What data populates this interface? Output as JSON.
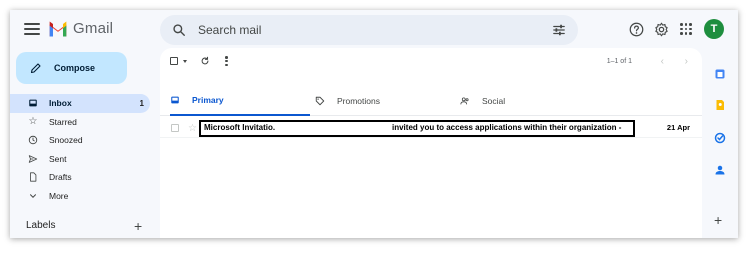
{
  "app": {
    "name": "Gmail",
    "avatar_initial": "T"
  },
  "search": {
    "placeholder": "Search mail"
  },
  "compose": {
    "label": "Compose"
  },
  "nav": {
    "items": [
      {
        "label": "Inbox",
        "count": "1",
        "icon": "inbox-icon"
      },
      {
        "label": "Starred",
        "count": "",
        "icon": "star-icon"
      },
      {
        "label": "Snoozed",
        "count": "",
        "icon": "clock-icon"
      },
      {
        "label": "Sent",
        "count": "",
        "icon": "send-icon"
      },
      {
        "label": "Drafts",
        "count": "",
        "icon": "draft-icon"
      },
      {
        "label": "More",
        "count": "",
        "icon": "chevron-down-icon"
      }
    ],
    "labels_title": "Labels",
    "labels_add": "+"
  },
  "toolbar": {
    "pager": "1–1 of 1"
  },
  "tabs": [
    {
      "label": "Primary",
      "icon": "inbox-icon"
    },
    {
      "label": "Promotions",
      "icon": "tag-icon"
    },
    {
      "label": "Social",
      "icon": "people-icon"
    }
  ],
  "emails": [
    {
      "sender": "Microsoft Invitatio.",
      "subject": "invited you to access applications within their organization -",
      "date": "21 Apr"
    }
  ],
  "colors": {
    "accent": "#0b57d0",
    "compose_bg": "#c2e7ff",
    "active_nav": "#d3e3fd",
    "avatar_bg": "#1e8e3e"
  }
}
